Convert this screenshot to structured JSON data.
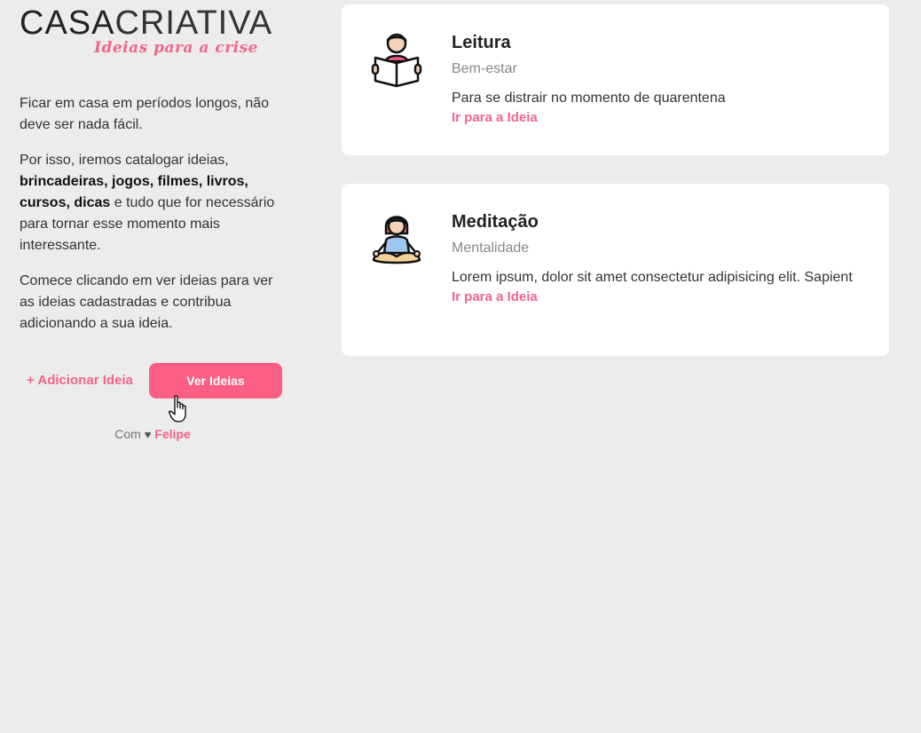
{
  "brand": {
    "logo_bold": "CASA",
    "logo_light": "CRIATIVA",
    "tagline": "Ideias para a crise"
  },
  "intro": {
    "p1": "Ficar em casa em períodos longos, não deve ser nada fácil.",
    "p2_start": "Por isso, iremos catalogar ideias,",
    "p2_bold": "brincadeiras, jogos, filmes, livros, cursos, dicas",
    "p2_end": "e tudo que for necessário para tornar esse momento mais interessante.",
    "p3": "Comece clicando em ver ideias para ver as ideias cadastradas e contribua adicionando a sua ideia."
  },
  "actions": {
    "add_label": "+ Adicionar Ideia",
    "view_label": "Ver Ideias"
  },
  "credits": {
    "prefix": "Com",
    "heart": "♥",
    "author": "Felipe"
  },
  "cards": [
    {
      "icon": "reading-person-icon",
      "title": "Leitura",
      "category": "Bem-estar",
      "description": "Para se distrair no momento de quarentena",
      "link": "Ir para a Ideia"
    },
    {
      "icon": "meditation-person-icon",
      "title": "Meditação",
      "category": "Mentalidade",
      "description": "Lorem ipsum, dolor sit amet consectetur adipisicing elit. Sapient",
      "link": "Ir para a Ideia"
    }
  ],
  "colors": {
    "accent": "#fa5f83",
    "background": "#ececec",
    "card": "#ffffff"
  }
}
